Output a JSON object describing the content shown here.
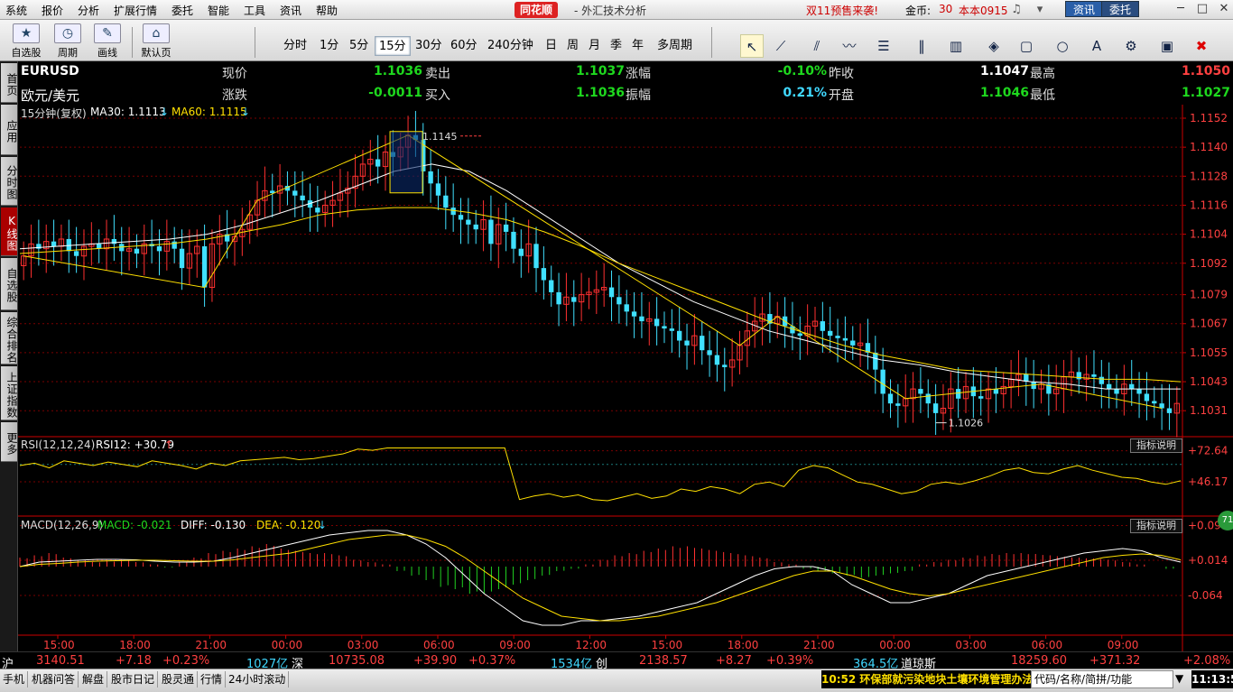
{
  "menubar": {
    "items": [
      "系统",
      "报价",
      "分析",
      "扩展行情",
      "委托",
      "智能",
      "工具",
      "资讯",
      "帮助"
    ],
    "brand": "同花顺",
    "brand_sub": "- 外汇技术分析",
    "promo": "双11预售来袭!",
    "coin_label": "金币:",
    "coin_value": "30",
    "version": "本本0915",
    "news_btn": "资讯",
    "trade_btn": "委托"
  },
  "toolbar": {
    "groups": [
      {
        "icon": "star-icon",
        "label": "自选股"
      },
      {
        "icon": "clock-icon",
        "label": "周期"
      },
      {
        "icon": "pencil-icon",
        "label": "画线"
      },
      {
        "icon": "home-icon",
        "label": "默认页"
      }
    ],
    "periods": [
      "分时",
      "1分",
      "5分",
      "15分",
      "30分",
      "60分",
      "240分钟",
      "日",
      "周",
      "月",
      "季",
      "年",
      "多周期"
    ],
    "active_period": "15分"
  },
  "lefttabs": [
    "首页",
    "应用",
    "分时图",
    "K线图",
    "自选股",
    "综合排名",
    "上证指数",
    "更多"
  ],
  "active_tab": "K线图",
  "quote": {
    "symbol": "EURUSD",
    "name": "欧元/美元",
    "fields": [
      {
        "label": "现价",
        "value": "1.1036",
        "color": "green"
      },
      {
        "label": "卖出",
        "value": "1.1037",
        "color": "green"
      },
      {
        "label": "涨幅",
        "value": "-0.10%",
        "color": "green"
      },
      {
        "label": "昨收",
        "value": "1.1047",
        "color": "white"
      },
      {
        "label": "最高",
        "value": "1.1050",
        "color": "red"
      },
      {
        "label": "涨跌",
        "value": "-0.0011",
        "color": "green"
      },
      {
        "label": "买入",
        "value": "1.1036",
        "color": "green"
      },
      {
        "label": "振幅",
        "value": "0.21%",
        "color": "cyan"
      },
      {
        "label": "开盘",
        "value": "1.1046",
        "color": "green"
      },
      {
        "label": "最低",
        "value": "1.1027",
        "color": "green"
      }
    ]
  },
  "main_head": {
    "period": "15分钟(复权)",
    "ma30": "MA30: 1.1113",
    "ma60": "MA60: 1.1115"
  },
  "rsi_head": {
    "label": "RSI(12,12,24)",
    "value": "RSI12: +30.79"
  },
  "macd_head": {
    "label": "MACD(12,26,9)",
    "macd": "MACD: -0.021",
    "diff": "DIFF: -0.130",
    "dea": "DEA: -0.120"
  },
  "help_label": "指标说明",
  "float_badge": "71",
  "chart_data": {
    "type": "candlestick",
    "title": "EURUSD 15分钟",
    "price_axis": [
      "1.1152",
      "1.1140",
      "1.1128",
      "1.1116",
      "1.1104",
      "1.1092",
      "1.1079",
      "1.1067",
      "1.1055",
      "1.1043",
      "1.1031"
    ],
    "price_range": [
      1.1021,
      1.1152
    ],
    "time_labels": [
      "15:00",
      "18:00",
      "21:00",
      "00:00",
      "03:00",
      "06:00",
      "09:00",
      "12:00",
      "15:00",
      "18:00",
      "21:00",
      "00:00",
      "03:00",
      "06:00",
      "09:00"
    ],
    "high_marker": "1.1145",
    "low_marker": "1.1026",
    "closes": [
      1.1095,
      1.11,
      1.1098,
      1.1101,
      1.1099,
      1.1102,
      1.1097,
      1.1095,
      1.1099,
      1.11,
      1.1098,
      1.1102,
      1.11,
      1.1097,
      1.1098,
      1.1096,
      1.11,
      1.1099,
      1.1097,
      1.1101,
      1.1098,
      1.109,
      1.1096,
      1.1099,
      1.1082,
      1.11,
      1.1104,
      1.1101,
      1.1103,
      1.1106,
      1.1112,
      1.1118,
      1.1122,
      1.1121,
      1.1124,
      1.1122,
      1.112,
      1.1118,
      1.1115,
      1.1113,
      1.1116,
      1.1118,
      1.1121,
      1.1123,
      1.1128,
      1.1133,
      1.1135,
      1.1132,
      1.1138,
      1.1136,
      1.114,
      1.1145,
      1.1143,
      1.113,
      1.1125,
      1.112,
      1.1115,
      1.1112,
      1.111,
      1.1108,
      1.1106,
      1.111,
      1.11,
      1.1108,
      1.1105,
      1.1098,
      1.1095,
      1.11,
      1.109,
      1.1085,
      1.108,
      1.1075,
      1.1078,
      1.1076,
      1.1079,
      1.108,
      1.1081,
      1.1082,
      1.1078,
      1.1075,
      1.1072,
      1.107,
      1.1068,
      1.1069,
      1.1066,
      1.1065,
      1.1064,
      1.106,
      1.1058,
      1.1062,
      1.1056,
      1.1054,
      1.105,
      1.1049,
      1.1052,
      1.1058,
      1.1064,
      1.1068,
      1.1071,
      1.1067,
      1.107,
      1.1066,
      1.1063,
      1.1062,
      1.1066,
      1.1068,
      1.1064,
      1.1062,
      1.1061,
      1.106,
      1.1058,
      1.1059,
      1.1055,
      1.1048,
      1.1038,
      1.1034,
      1.1033,
      1.1036,
      1.104,
      1.1038,
      1.1034,
      1.103,
      1.1032,
      1.104,
      1.1036,
      1.1041,
      1.1037,
      1.1036,
      1.104,
      1.1038,
      1.1041,
      1.1044,
      1.1046,
      1.1043,
      1.104,
      1.1042,
      1.1038,
      1.104,
      1.1045,
      1.1047,
      1.1044,
      1.1046,
      1.1045,
      1.1042,
      1.104,
      1.1038,
      1.1042,
      1.104,
      1.1038,
      1.1035,
      1.1034,
      1.1032,
      1.103,
      1.1034
    ],
    "ma30": [
      1.1098,
      1.1099,
      1.11,
      1.1101,
      1.1102,
      1.1104,
      1.1108,
      1.1113,
      1.1118,
      1.1124,
      1.113,
      1.1133,
      1.113,
      1.1122,
      1.1112,
      1.1102,
      1.1092,
      1.1084,
      1.1076,
      1.107,
      1.1064,
      1.106,
      1.1056,
      1.1052,
      1.105,
      1.1047,
      1.1045,
      1.1043,
      1.1042,
      1.104,
      1.104,
      1.104
    ],
    "ma60": [
      1.1096,
      1.1097,
      1.1098,
      1.1099,
      1.11,
      1.1102,
      1.1105,
      1.1108,
      1.1112,
      1.1114,
      1.1115,
      1.1115,
      1.1113,
      1.111,
      1.1105,
      1.1099,
      1.1092,
      1.1086,
      1.108,
      1.1074,
      1.1068,
      1.1063,
      1.1058,
      1.1054,
      1.1051,
      1.1048,
      1.1047,
      1.1046,
      1.1045,
      1.1044,
      1.1044,
      1.1043
    ],
    "rsi_axis": [
      "+72.64",
      "+46.17"
    ],
    "rsi": [
      60,
      62,
      58,
      64,
      62,
      60,
      63,
      61,
      59,
      64,
      62,
      60,
      57,
      62,
      60,
      64,
      65,
      66,
      67,
      65,
      66,
      68,
      70,
      74,
      73,
      75,
      75,
      75,
      75,
      75,
      75,
      75,
      75,
      75,
      31,
      34,
      36,
      33,
      35,
      31,
      30,
      33,
      36,
      32,
      34,
      40,
      38,
      42,
      40,
      36,
      44,
      46,
      42,
      56,
      60,
      58,
      52,
      46,
      44,
      40,
      36,
      38,
      44,
      46,
      44,
      47,
      51,
      56,
      58,
      54,
      53,
      57,
      60,
      56,
      53,
      50,
      49,
      46,
      44,
      47
    ],
    "macd_axis": [
      "+0.091",
      "+0.014",
      "-0.064"
    ],
    "macd_hist": [
      0.02,
      0.025,
      0.03,
      0.02,
      0.015,
      0.01,
      0.012,
      0.015,
      0.01,
      0.005,
      -0.002,
      0.01,
      0.02,
      0.03,
      0.035,
      0.04,
      0.045,
      0.05,
      0.04,
      0.035,
      0.03,
      0.03,
      0.025,
      0.015,
      0.01,
      0.005,
      -0.01,
      -0.02,
      -0.03,
      -0.045,
      -0.05,
      -0.06,
      -0.06,
      -0.05,
      -0.04,
      -0.03,
      -0.02,
      -0.01,
      -0.005,
      0.005,
      0.015,
      0.025,
      0.03,
      0.035,
      0.04,
      0.045,
      0.045,
      0.04,
      0.035,
      0.03,
      0.025,
      0.02,
      0.01,
      0.005,
      -0.005,
      -0.01,
      -0.015,
      -0.02,
      -0.025,
      -0.02,
      -0.015,
      -0.01,
      0.005,
      0.01,
      0.015,
      0.02,
      0.025,
      0.028,
      0.03,
      0.03,
      0.028,
      0.025,
      0.022,
      0.02,
      0.018,
      0.015,
      0.01,
      0.005,
      0.0,
      -0.005
    ],
    "diff": [
      0.0,
      0.01,
      0.012,
      0.014,
      0.016,
      0.016,
      0.015,
      0.012,
      0.01,
      0.01,
      0.012,
      0.02,
      0.03,
      0.04,
      0.05,
      0.06,
      0.07,
      0.075,
      0.08,
      0.08,
      0.07,
      0.05,
      0.02,
      -0.02,
      -0.06,
      -0.09,
      -0.12,
      -0.13,
      -0.13,
      -0.12,
      -0.12,
      -0.115,
      -0.11,
      -0.1,
      -0.09,
      -0.08,
      -0.06,
      -0.04,
      -0.02,
      -0.005,
      0.0,
      0.0,
      -0.01,
      -0.04,
      -0.06,
      -0.08,
      -0.08,
      -0.07,
      -0.06,
      -0.04,
      -0.02,
      -0.01,
      0.0,
      0.01,
      0.02,
      0.03,
      0.035,
      0.04,
      0.035,
      0.02,
      0.01
    ],
    "dea": [
      0.0,
      0.005,
      0.007,
      0.01,
      0.012,
      0.013,
      0.014,
      0.014,
      0.013,
      0.012,
      0.012,
      0.015,
      0.02,
      0.025,
      0.03,
      0.04,
      0.05,
      0.06,
      0.065,
      0.07,
      0.07,
      0.06,
      0.045,
      0.02,
      -0.01,
      -0.04,
      -0.07,
      -0.09,
      -0.11,
      -0.115,
      -0.12,
      -0.12,
      -0.115,
      -0.11,
      -0.1,
      -0.09,
      -0.08,
      -0.065,
      -0.05,
      -0.035,
      -0.02,
      -0.01,
      -0.01,
      -0.02,
      -0.035,
      -0.05,
      -0.06,
      -0.065,
      -0.06,
      -0.05,
      -0.04,
      -0.03,
      -0.02,
      -0.01,
      0.0,
      0.01,
      0.02,
      0.025,
      0.028,
      0.025,
      0.015
    ]
  },
  "indexbar": [
    {
      "text": "沪",
      "color": "white"
    },
    {
      "text": "3140.51",
      "color": "red"
    },
    {
      "text": "+7.18",
      "color": "red"
    },
    {
      "text": "+0.23%",
      "color": "red"
    },
    {
      "text": "1027亿",
      "color": "cyan"
    },
    {
      "text": "深",
      "color": "white"
    },
    {
      "text": "10735.08",
      "color": "red"
    },
    {
      "text": "+39.90",
      "color": "red"
    },
    {
      "text": "+0.37%",
      "color": "red"
    },
    {
      "text": "1534亿",
      "color": "cyan"
    },
    {
      "text": "创",
      "color": "white"
    },
    {
      "text": "2138.57",
      "color": "red"
    },
    {
      "text": "+8.27",
      "color": "red"
    },
    {
      "text": "+0.39%",
      "color": "red"
    },
    {
      "text": "364.5亿",
      "color": "cyan"
    },
    {
      "text": "道琼斯",
      "color": "white"
    },
    {
      "text": "18259.60",
      "color": "red"
    },
    {
      "text": "+371.32",
      "color": "red"
    },
    {
      "text": "+2.08%",
      "color": "red"
    }
  ],
  "status": {
    "items": [
      "手机",
      "机器问答",
      "解盘",
      "股市日记",
      "股灵通",
      "行情",
      "24小时滚动"
    ],
    "news": "10:52 环保部就污染地块土壤环境管理办法",
    "search_placeholder": "代码/名称/简拼/功能",
    "clock": "11:13:52"
  }
}
